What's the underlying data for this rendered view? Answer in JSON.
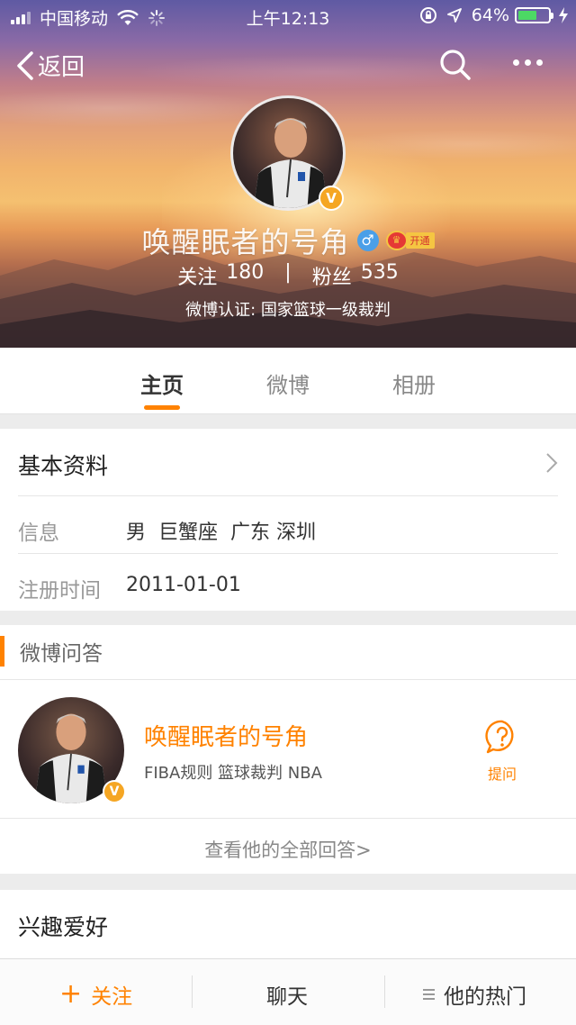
{
  "status_bar": {
    "carrier": "中国移动",
    "time": "上午12:13",
    "battery": "64%",
    "battery_level": 0.64
  },
  "nav": {
    "back_label": "返回"
  },
  "profile": {
    "username": "唤醒眠者的号角",
    "gender": "♂",
    "vip_open": "开通",
    "following_label": "关注",
    "following_count": "180",
    "stats_separator": "|",
    "followers_label": "粉丝",
    "followers_count": "535",
    "verification": "微博认证: 国家篮球一级裁判",
    "verified_mark": "V"
  },
  "tabs": [
    {
      "label": "主页",
      "active": true
    },
    {
      "label": "微博",
      "active": false
    },
    {
      "label": "相册",
      "active": false
    }
  ],
  "basic_info": {
    "title": "基本资料",
    "rows": [
      {
        "label": "信息",
        "value": "男  巨蟹座  广东 深圳"
      },
      {
        "label": "注册时间",
        "value": "2011-01-01"
      }
    ]
  },
  "weibo_qa": {
    "title": "微博问答",
    "name": "唤醒眠者的号角",
    "tags": "FIBA规则 篮球裁判 NBA",
    "ask_label": "提问",
    "view_all": "查看他的全部回答>"
  },
  "hobbies": {
    "title": "兴趣爱好"
  },
  "bottom_bar": {
    "follow_plus": "+",
    "follow": "关注",
    "chat": "聊天",
    "hot": "他的热门"
  },
  "colors": {
    "accent": "#ff8200",
    "verified_badge": "#f5a623",
    "gender_blue": "#4a9fe8",
    "battery_green": "#4cd964"
  }
}
